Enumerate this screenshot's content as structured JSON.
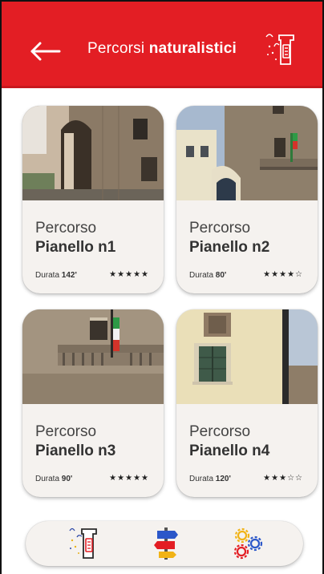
{
  "header": {
    "title_regular": "Percorsi",
    "title_bold": "naturalistici",
    "back_icon": "arrow-left-icon",
    "logo_icon": "brand-tower-logo-icon",
    "bg_color": "#e31e24"
  },
  "routes": [
    {
      "prefix": "Percorso",
      "name": "Pianello n1",
      "duration_label": "Durata",
      "duration": "142'",
      "rating": 5,
      "stars_text": "★★★★★"
    },
    {
      "prefix": "Percorso",
      "name": "Pianello n2",
      "duration_label": "Durata",
      "duration": "80'",
      "rating": 4,
      "stars_text": "★★★★☆"
    },
    {
      "prefix": "Percorso",
      "name": "Pianello n3",
      "duration_label": "Durata",
      "duration": "90'",
      "rating": 5,
      "stars_text": "★★★★★"
    },
    {
      "prefix": "Percorso",
      "name": "Pianello n4",
      "duration_label": "Durata",
      "duration": "120'",
      "rating": 3,
      "stars_text": "★★★☆☆"
    }
  ],
  "bottom_nav": {
    "items": [
      "home-tower-icon",
      "signpost-icon",
      "settings-gears-icon"
    ]
  }
}
